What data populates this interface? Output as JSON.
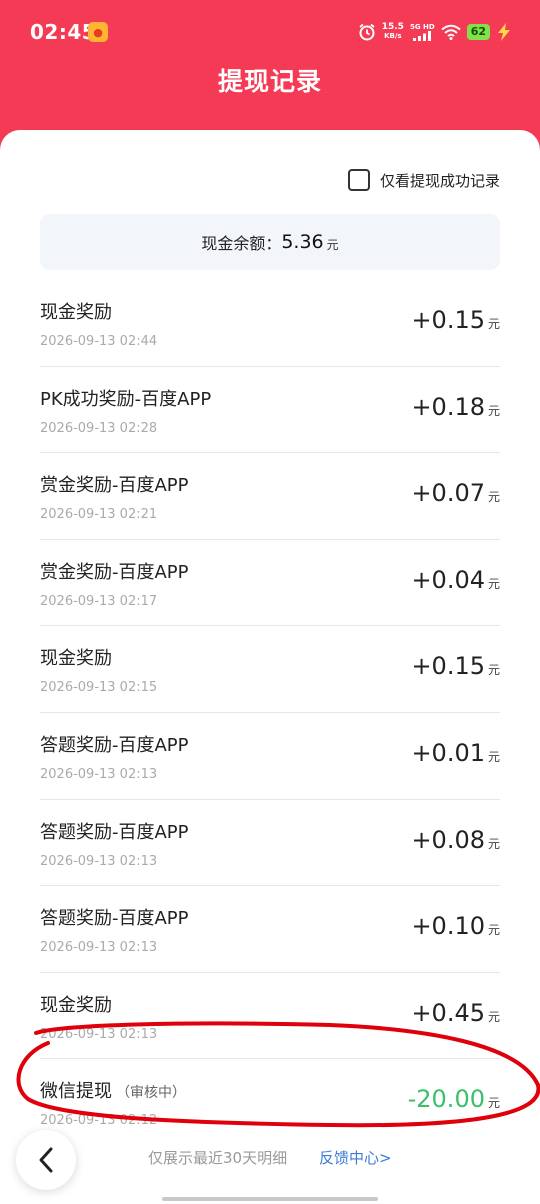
{
  "status_bar": {
    "time": "02:45",
    "net_speed_value": "15.5",
    "net_speed_unit": "KB/s",
    "signal_label": "5G HD",
    "battery": "62"
  },
  "header": {
    "title": "提现记录"
  },
  "filter": {
    "label": "仅看提现成功记录",
    "checked": false
  },
  "balance": {
    "label": "现金余额：",
    "value": "5.36",
    "unit": "元"
  },
  "records": [
    {
      "title": "现金奖励",
      "status": "",
      "time": "2026-09-13 02:44",
      "amount": "+0.15",
      "unit": "元"
    },
    {
      "title": "PK成功奖励-百度APP",
      "status": "",
      "time": "2026-09-13 02:28",
      "amount": "+0.18",
      "unit": "元"
    },
    {
      "title": "赏金奖励-百度APP",
      "status": "",
      "time": "2026-09-13 02:21",
      "amount": "+0.07",
      "unit": "元"
    },
    {
      "title": "赏金奖励-百度APP",
      "status": "",
      "time": "2026-09-13 02:17",
      "amount": "+0.04",
      "unit": "元"
    },
    {
      "title": "现金奖励",
      "status": "",
      "time": "2026-09-13 02:15",
      "amount": "+0.15",
      "unit": "元"
    },
    {
      "title": "答题奖励-百度APP",
      "status": "",
      "time": "2026-09-13 02:13",
      "amount": "+0.01",
      "unit": "元"
    },
    {
      "title": "答题奖励-百度APP",
      "status": "",
      "time": "2026-09-13 02:13",
      "amount": "+0.08",
      "unit": "元"
    },
    {
      "title": "答题奖励-百度APP",
      "status": "",
      "time": "2026-09-13 02:13",
      "amount": "+0.10",
      "unit": "元"
    },
    {
      "title": "现金奖励",
      "status": "",
      "time": "2026-09-13 02:13",
      "amount": "+0.45",
      "unit": "元"
    },
    {
      "title": "微信提现",
      "status": "（审核中）",
      "time": "2026-09-13 02:12",
      "amount": "-20.00",
      "unit": "元"
    }
  ],
  "footer": {
    "note": "仅展示最近30天明细",
    "feedback": "反馈中心>"
  },
  "colors": {
    "brand_red": "#f53a55",
    "link_blue": "#3a7bd5",
    "withdraw_green": "#3bbf6a",
    "annotation_red": "#e0000b"
  }
}
